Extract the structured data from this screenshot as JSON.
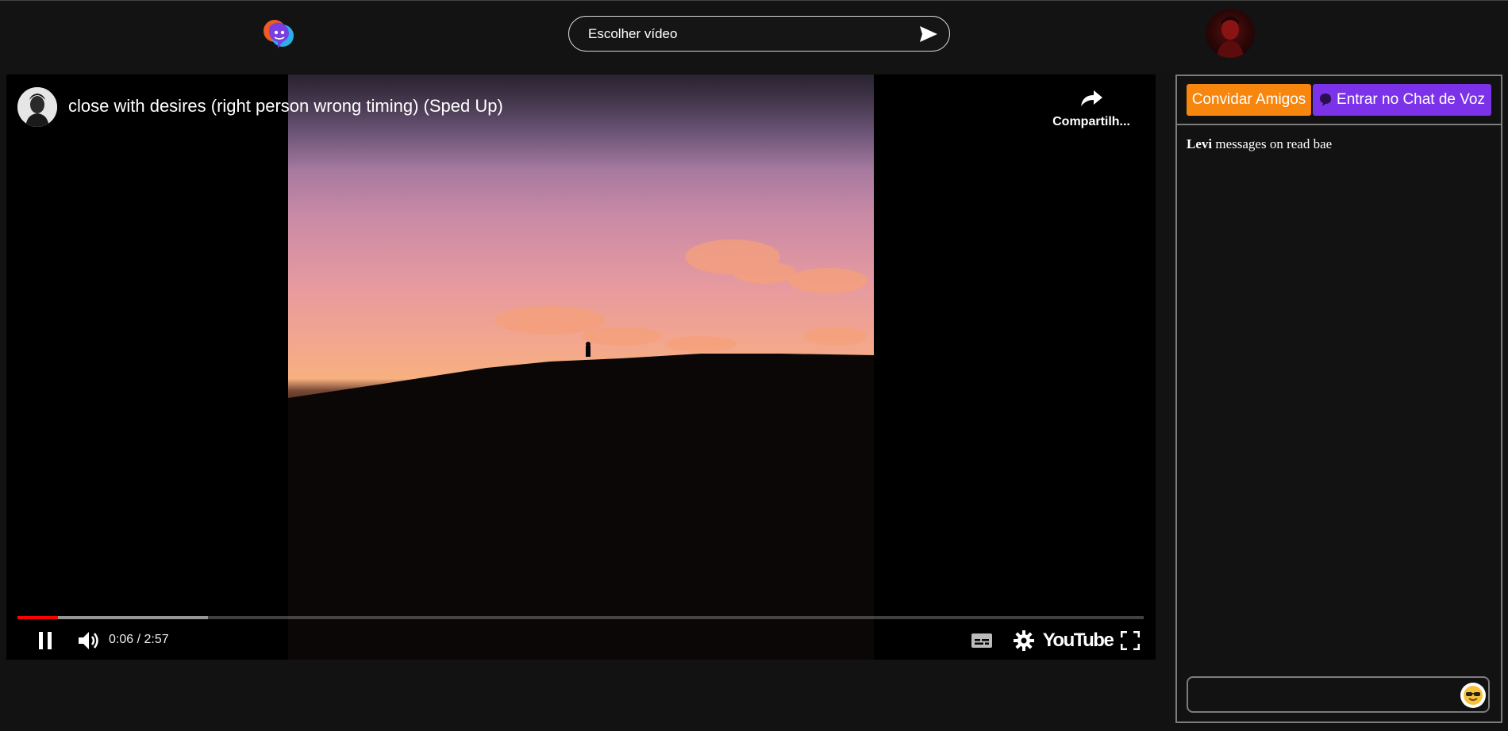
{
  "header": {
    "logo_icon": "chat-bubbles-logo-icon",
    "search": {
      "placeholder": "Escolher vídeo",
      "value": ""
    },
    "send_icon": "send-icon",
    "avatar_icon": "user-avatar"
  },
  "player": {
    "title": "close with desires (right person wrong timing) (Sped Up)",
    "share_label": "Compartilh...",
    "time_current": "0:06",
    "time_total": "2:57",
    "time_display": "0:06 / 2:57",
    "progress_played_fraction": 0.036,
    "progress_buffered_fraction": 0.169,
    "brand_label": "YouTube"
  },
  "sidebar": {
    "invite_label": "Convidar Amigos",
    "voice_label": "Entrar no Chat de Voz",
    "messages": [
      {
        "user": "Levi",
        "text": "messages on read bae"
      }
    ],
    "chat_input": {
      "placeholder": "",
      "value": ""
    },
    "emoji_icon": "sunglasses-emoji-icon"
  },
  "colors": {
    "background": "#121212",
    "invite_button": "#f7860f",
    "voice_button": "#7b32e8",
    "progress_played": "#ff0000"
  }
}
